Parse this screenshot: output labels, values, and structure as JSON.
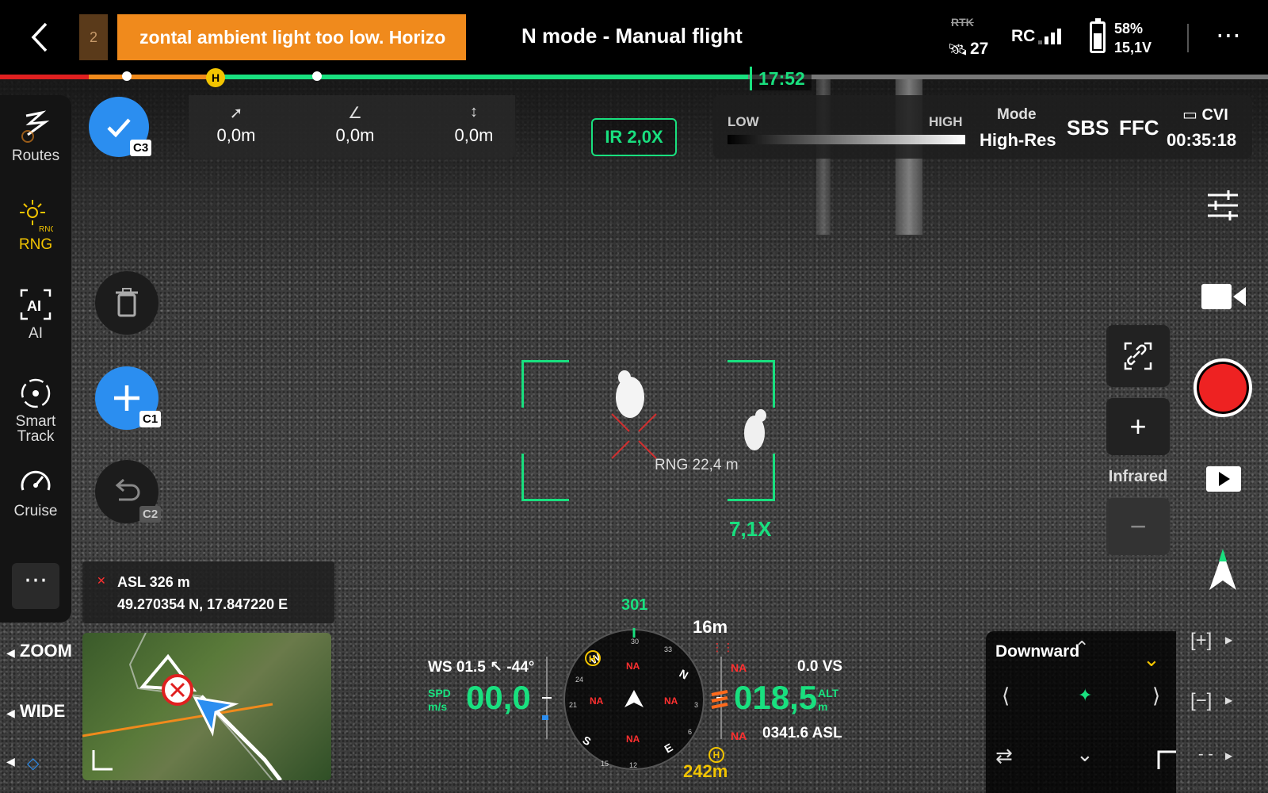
{
  "topbar": {
    "queue_count": "2",
    "warning_text": "zontal ambient light too low. Horizo",
    "flight_mode": "N mode - Manual flight",
    "rtk_label": "RTK",
    "satellite_count": "27",
    "rc_label": "RC",
    "battery_percent": "58%",
    "battery_voltage": "15,1V",
    "battery_level": 0.58,
    "more_icon": "more-dots-icon"
  },
  "timeline": {
    "home_label": "H",
    "time_remaining": "17:52"
  },
  "left_rail": {
    "items": [
      {
        "label": "Routes",
        "icon": "routes-icon"
      },
      {
        "label": "RNG",
        "icon": "laser-rangefinder-icon",
        "active": true
      },
      {
        "label": "AI",
        "icon": "ai-icon"
      },
      {
        "label": "Smart Track",
        "line1": "Smart",
        "line2": "Track",
        "icon": "smart-track-icon"
      },
      {
        "label": "Cruise",
        "icon": "speedometer-icon"
      }
    ],
    "more_label": "..."
  },
  "floating": {
    "confirm_tag": "C3",
    "add_tag": "C1",
    "undo_tag": "C2"
  },
  "measure": {
    "distance": "0,0m",
    "angle": "0,0m",
    "height": "0,0m"
  },
  "camera": {
    "ir_zoom": "IR  2,0X",
    "target_zoom": "7,1X",
    "rng_text": "RNG 22,4 m"
  },
  "palette": {
    "low": "LOW",
    "high": "HIGH",
    "mode_label": "Mode",
    "mode_value": "High-Res",
    "sbs": "SBS",
    "ffc": "FFC",
    "storage": "CVI",
    "rec_time": "00:35:18"
  },
  "gps": {
    "asl": "ASL 326 m",
    "coords": "49.270354 N, 17.847220 E"
  },
  "lens": {
    "zoom": "ZOOM",
    "wide": "WIDE"
  },
  "hud": {
    "wind": "WS 01.5 ↖ -44°",
    "speed_unit_top": "SPD",
    "speed_unit_bottom": "m/s",
    "speed": "00,0",
    "heading": "301",
    "compass_w": "W",
    "compass_n": "N",
    "compass_s": "S",
    "compass_e": "E",
    "tick_30": "30",
    "tick_33": "33",
    "tick_24": "24",
    "tick_21": "21",
    "tick_3": "3",
    "tick_6": "6",
    "tick_15": "15",
    "tick_12": "12",
    "na": "NA",
    "home_distance": "242m",
    "obstacle_distance": "16m",
    "altitude": "018,5",
    "alt_unit_top": "ALT",
    "alt_unit_bottom": "m",
    "vertical_speed": "0.0 VS",
    "asl": "0341.6 ASL",
    "home_label": "H"
  },
  "zoom_panel": {
    "plus": "+",
    "minus": "−",
    "label": "Infrared"
  },
  "downward": {
    "label": "Downward",
    "zoom_in": "[+]",
    "zoom_out": "[−]"
  },
  "colors": {
    "accent_green": "#19e07f",
    "warning_orange": "#f08a1c",
    "home_yellow": "#f2c400",
    "record_red": "#ee2222",
    "action_blue": "#2b8ef0"
  }
}
